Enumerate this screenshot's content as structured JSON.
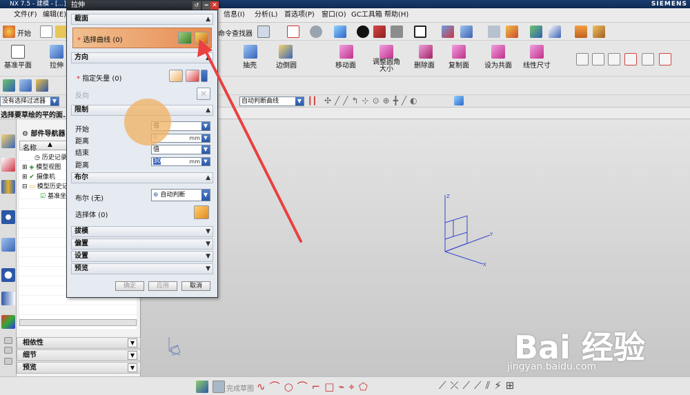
{
  "app": {
    "title": "NX 7.5 - 建模 - [...]",
    "brand": "SIEMENS"
  },
  "menu": {
    "items": [
      "文件(F)",
      "编辑(E)",
      "信息(I)",
      "分析(L)",
      "首选项(P)",
      "窗口(O)",
      "GC工具箱",
      "帮助(H)"
    ]
  },
  "toolbar1": {
    "start_label": "开始",
    "command_finder": "命令查找器"
  },
  "toolbar2": {
    "left_items": [
      "基准平面",
      "拉伸"
    ],
    "right_items": [
      "抽壳",
      "边倒圆",
      "移动面",
      "调整圆角大小",
      "删除面",
      "复制面",
      "设为共面",
      "线性尺寸"
    ]
  },
  "selection": {
    "filter": "没有选择过滤器",
    "curve_rule": "自动判断曲线"
  },
  "status": {
    "prompt": "选择要草绘的平的面..."
  },
  "dialog": {
    "title": "拉伸",
    "sections": {
      "section": "截面",
      "direction": "方向",
      "limits": "限制",
      "boolean": "布尔",
      "draft": "拔模",
      "offset": "偏置",
      "settings": "设置",
      "preview": "预览"
    },
    "select_curve": {
      "label": "选择曲线",
      "count": "(0)"
    },
    "specify_vector": {
      "label": "指定矢量",
      "count": "(0)"
    },
    "reverse_label": "反向",
    "start": {
      "label": "开始",
      "option": "值"
    },
    "start_distance": {
      "label": "距离",
      "value": "0",
      "unit": "mm"
    },
    "end": {
      "label": "结束",
      "option": "值"
    },
    "end_distance": {
      "label": "距离",
      "value": "30",
      "unit": "mm"
    },
    "boolean_row": {
      "label": "布尔 (无)",
      "option": "自动判断"
    },
    "select_body": {
      "label": "选择体",
      "count": "(0)"
    },
    "buttons": {
      "ok": "确定",
      "apply": "应用",
      "cancel": "取消"
    }
  },
  "navigator": {
    "title": "部件导航器",
    "column": "名称",
    "items": [
      "历史记录模式",
      "模型视图",
      "摄像机",
      "模型历史记录",
      "基准坐标系"
    ],
    "panels": [
      "相依性",
      "细节",
      "预览"
    ]
  },
  "bottom": {
    "finish_sketch": "完成草图"
  },
  "axes": {
    "x": "X",
    "y": "Y",
    "z": "Z"
  },
  "watermark": {
    "text": "Bai 经验",
    "url": "jingyan.baidu.com"
  },
  "colors": {
    "accent_blue": "#2c57a6",
    "highlight_orange": "#f0b060",
    "annotation_red": "#ea4040"
  }
}
